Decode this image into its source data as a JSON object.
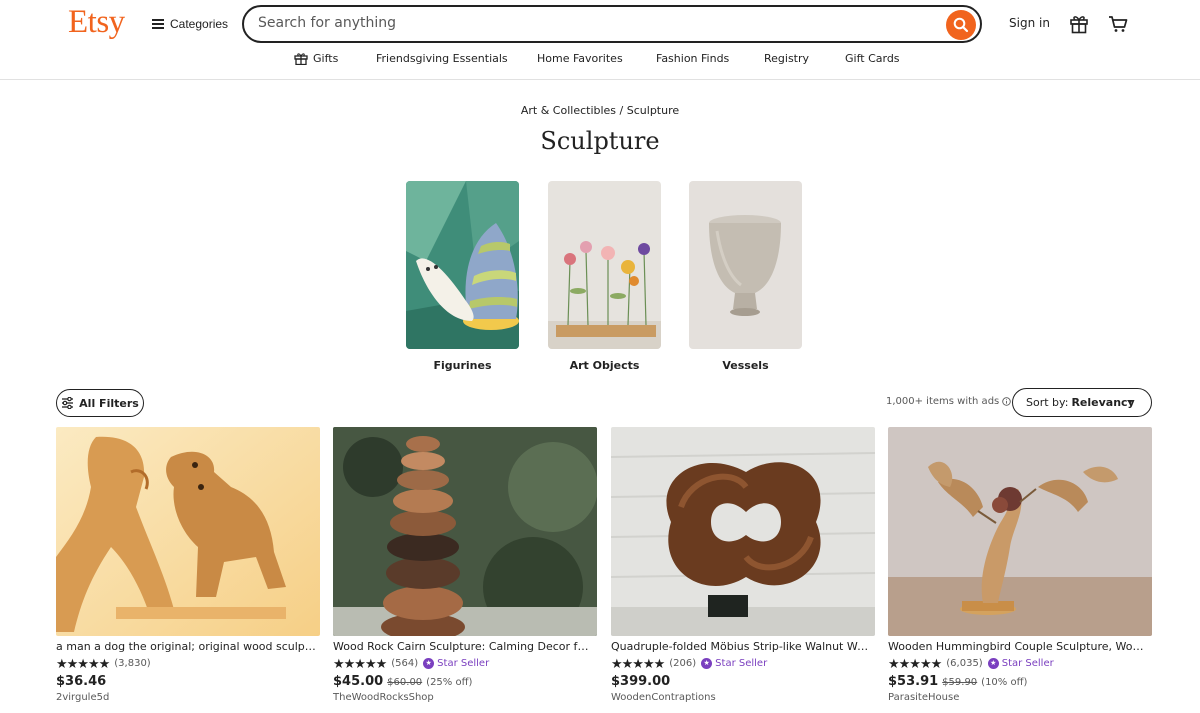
{
  "header": {
    "logo": "Etsy",
    "categories_label": "Categories",
    "search_placeholder": "Search for anything",
    "signin_label": "Sign in"
  },
  "nav": {
    "items": [
      {
        "label": "Gifts",
        "icon": "gift-icon"
      },
      {
        "label": "Friendsgiving Essentials"
      },
      {
        "label": "Home Favorites"
      },
      {
        "label": "Fashion Finds"
      },
      {
        "label": "Registry"
      },
      {
        "label": "Gift Cards"
      }
    ]
  },
  "breadcrumb": {
    "parent": "Art & Collectibles",
    "separator": "/",
    "current": "Sculpture"
  },
  "page_title": "Sculpture",
  "subcategories": [
    {
      "label": "Figurines"
    },
    {
      "label": "Art Objects"
    },
    {
      "label": "Vessels"
    }
  ],
  "toolbar": {
    "filters_label": "All Filters",
    "results_text": "1,000+ items with ads",
    "sort_prefix": "Sort by:",
    "sort_value": "Relevancy"
  },
  "listings": [
    {
      "title": "a man a dog the original; original wood sculpture, wooden figurine, man and dog gift",
      "stars": "★★★★★",
      "reviews": "(3,830)",
      "star_seller": "",
      "price": "$36.46",
      "original_price": "",
      "discount": "",
      "shop": "2virgule5d"
    },
    {
      "title": "Wood Rock Cairn Sculpture: Calming Decor for Home",
      "stars": "★★★★★",
      "reviews": "(564)",
      "star_seller": "Star Seller",
      "price": "$45.00",
      "original_price": "$60.00",
      "discount": "(25% off)",
      "shop": "TheWoodRocksShop"
    },
    {
      "title": "Quadruple-folded Möbius Strip-like Walnut Wood Sculpture",
      "stars": "★★★★★",
      "reviews": "(206)",
      "star_seller": "Star Seller",
      "price": "$399.00",
      "original_price": "",
      "discount": "",
      "shop": "WoodenContraptions"
    },
    {
      "title": "Wooden Hummingbird Couple Sculpture, Wood Carving",
      "stars": "★★★★★",
      "reviews": "(6,035)",
      "star_seller": "Star Seller",
      "price": "$53.91",
      "original_price": "$59.90",
      "discount": "(10% off)",
      "shop": "ParasiteHouse"
    }
  ],
  "colors": {
    "brand": "#f1641e",
    "star_seller": "#7a3fbf",
    "text": "#222222"
  }
}
